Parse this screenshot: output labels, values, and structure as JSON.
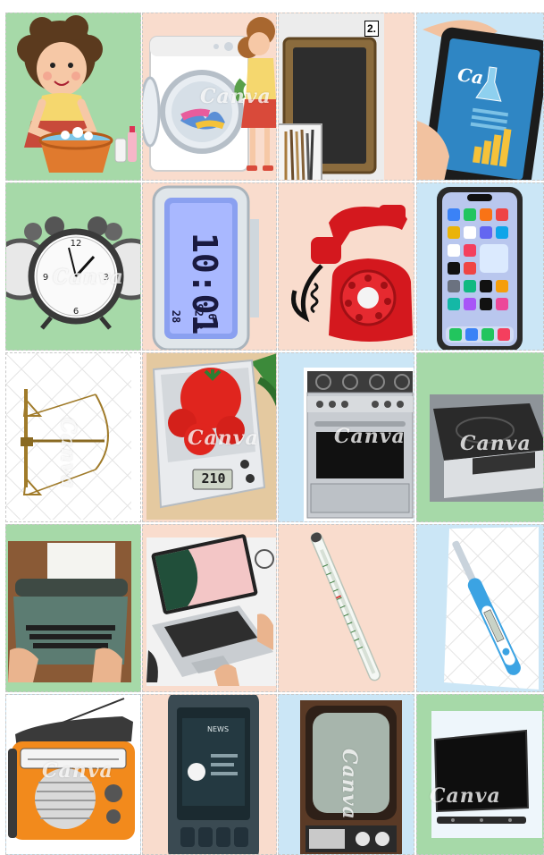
{
  "watermark": "Canva",
  "badge_label": "2.",
  "colors": {
    "green": "#a6d9a8",
    "peach": "#f9dccd",
    "blue": "#cbe6f6",
    "white": "#ffffff"
  },
  "tiles": [
    {
      "row": 1,
      "col": 1,
      "bg": "green",
      "icon": "handwashing-laundry-icon"
    },
    {
      "row": 1,
      "col": 2,
      "bg": "peach",
      "icon": "washing-machine-icon"
    },
    {
      "row": 1,
      "col": 3,
      "bg": "peach",
      "icon": "slate-chalkboard-icon"
    },
    {
      "row": 1,
      "col": 4,
      "bg": "blue",
      "icon": "tablet-icon"
    },
    {
      "row": 2,
      "col": 1,
      "bg": "green",
      "icon": "alarm-clocks-icon"
    },
    {
      "row": 2,
      "col": 2,
      "bg": "peach",
      "icon": "digital-clock-icon"
    },
    {
      "row": 2,
      "col": 3,
      "bg": "peach",
      "icon": "rotary-telephone-icon"
    },
    {
      "row": 2,
      "col": 4,
      "bg": "blue",
      "icon": "smartphone-icon"
    },
    {
      "row": 3,
      "col": 1,
      "bg": "white",
      "icon": "balance-scale-icon"
    },
    {
      "row": 3,
      "col": 2,
      "bg": "peach",
      "icon": "kitchen-scale-icon"
    },
    {
      "row": 3,
      "col": 3,
      "bg": "blue",
      "icon": "gas-stove-oven-icon"
    },
    {
      "row": 3,
      "col": 4,
      "bg": "green",
      "icon": "induction-cooktop-icon"
    },
    {
      "row": 4,
      "col": 1,
      "bg": "green",
      "icon": "typewriter-icon"
    },
    {
      "row": 4,
      "col": 2,
      "bg": "peach",
      "icon": "laptop-icon"
    },
    {
      "row": 4,
      "col": 3,
      "bg": "peach",
      "icon": "glass-thermometer-icon"
    },
    {
      "row": 4,
      "col": 4,
      "bg": "blue",
      "icon": "digital-thermometer-icon"
    },
    {
      "row": 5,
      "col": 1,
      "bg": "blue",
      "icon": "retro-radio-icon"
    },
    {
      "row": 5,
      "col": 2,
      "bg": "peach",
      "icon": "car-dashboard-screen-icon"
    },
    {
      "row": 5,
      "col": 3,
      "bg": "blue",
      "icon": "old-television-icon"
    },
    {
      "row": 5,
      "col": 4,
      "bg": "green",
      "icon": "flat-screen-tv-icon"
    }
  ],
  "digital_clock": {
    "time": "10:01",
    "temp1": "28",
    "temp2": "92.8",
    "temp3": "6"
  },
  "scale_display": "210",
  "car_screen": "NEWS"
}
